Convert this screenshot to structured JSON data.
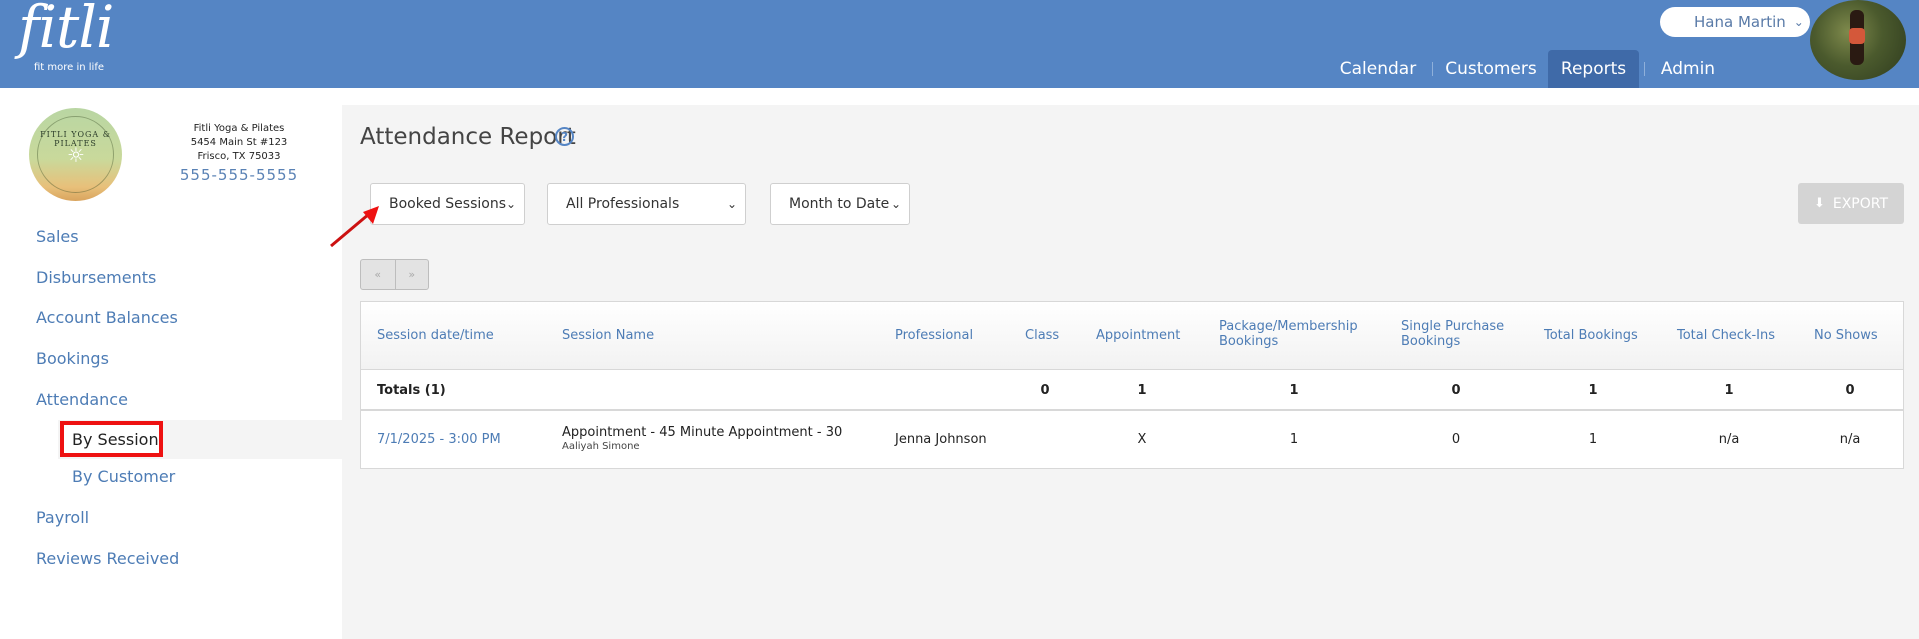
{
  "header": {
    "logo_text": "fitli",
    "logo_tagline": "fit more in life",
    "user_name": "Hana Martin",
    "nav": [
      {
        "label": "Calendar"
      },
      {
        "label": "Customers"
      },
      {
        "label": "Reports"
      },
      {
        "label": "Admin"
      }
    ]
  },
  "studio": {
    "logo_text": "FITLI YOGA & PILATES",
    "name": "Fitli Yoga & Pilates",
    "address1": "5454 Main St #123",
    "address2": "Frisco, TX 75033",
    "phone": "555-555-5555"
  },
  "sidebar": {
    "items": [
      {
        "label": "Sales"
      },
      {
        "label": "Disbursements"
      },
      {
        "label": "Account Balances"
      },
      {
        "label": "Bookings"
      },
      {
        "label": "Attendance"
      },
      {
        "label": "By Session"
      },
      {
        "label": "By Customer"
      },
      {
        "label": "Payroll"
      },
      {
        "label": "Reviews Received"
      }
    ]
  },
  "main": {
    "title": "Attendance Report",
    "filters": {
      "type": "Booked Sessions",
      "professional": "All Professionals",
      "range": "Month to Date"
    },
    "export_label": "EXPORT",
    "pager": {
      "prev": "«",
      "next": "»"
    },
    "table": {
      "headers": [
        {
          "line1": "Session date/time",
          "line2": ""
        },
        {
          "line1": "Session Name",
          "line2": ""
        },
        {
          "line1": "Professional",
          "line2": ""
        },
        {
          "line1": "Class",
          "line2": ""
        },
        {
          "line1": "Appointment",
          "line2": ""
        },
        {
          "line1": "Package/Membership",
          "line2": "Bookings"
        },
        {
          "line1": "Single Purchase",
          "line2": "Bookings"
        },
        {
          "line1": "Total Bookings",
          "line2": ""
        },
        {
          "line1": "Total Check-Ins",
          "line2": ""
        },
        {
          "line1": "No Shows",
          "line2": ""
        }
      ],
      "totals": {
        "label": "Totals (1)",
        "class": "0",
        "appointment": "1",
        "package": "1",
        "single": "0",
        "total_bookings": "1",
        "checkins": "1",
        "no_shows": "0"
      },
      "rows": [
        {
          "datetime": "7/1/2025 - 3:00 PM",
          "session_name": "Appointment - 45 Minute Appointment - 30",
          "customer": "Aaliyah Simone",
          "professional": "Jenna Johnson",
          "class": "",
          "appointment": "X",
          "package": "1",
          "single": "0",
          "total_bookings": "1",
          "checkins": "n/a",
          "no_shows": "n/a"
        }
      ]
    }
  },
  "colors": {
    "header_bg": "#5585c4",
    "nav_active": "#3f6aa8",
    "link": "#4d7cb5",
    "highlight_border": "#ee1111",
    "main_bg": "#f4f4f4"
  }
}
